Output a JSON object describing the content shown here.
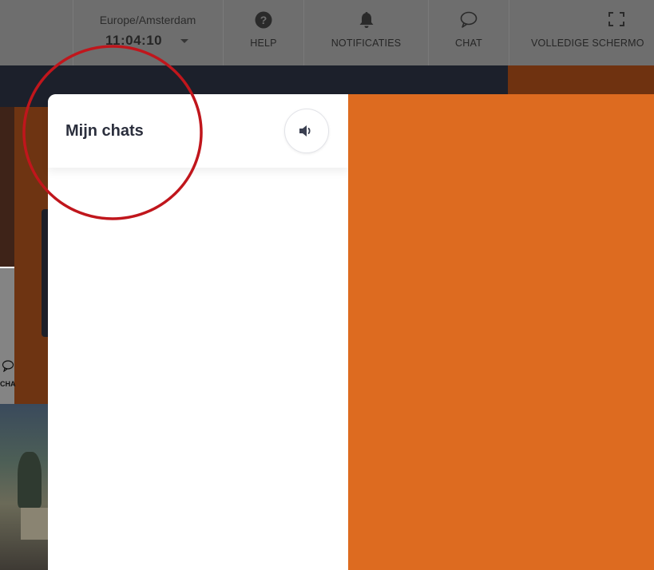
{
  "topbar": {
    "timezone": "Europe/Amsterdam",
    "time": "11:04:10",
    "help_label": "HELP",
    "notifications_label": "NOTIFICATIES",
    "chat_label": "CHAT",
    "fullscreen_label": "VOLLEDIGE SCHERMO"
  },
  "background": {
    "chat_label": "CHA"
  },
  "chat_panel": {
    "title": "Mijn chats"
  },
  "colors": {
    "accent_orange": "#dd6b20",
    "annotation_red": "#c0161c",
    "title_dark": "#2b2f3d"
  },
  "icons": [
    "question-circle-icon",
    "bell-icon",
    "chat-bubble-icon",
    "fullscreen-icon",
    "volume-icon"
  ]
}
